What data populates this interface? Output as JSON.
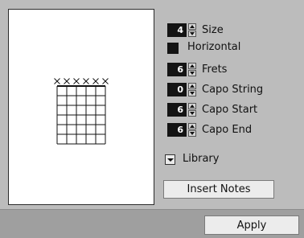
{
  "controls": {
    "size": {
      "value": "4",
      "label": "Size"
    },
    "horizontal": {
      "label": "Horizontal"
    },
    "frets": {
      "value": "6",
      "label": "Frets"
    },
    "capo_string": {
      "value": "0",
      "label": "Capo String"
    },
    "capo_start": {
      "value": "6",
      "label": "Capo Start"
    },
    "capo_end": {
      "value": "6",
      "label": "Capo End"
    },
    "library": {
      "label": "Library"
    }
  },
  "buttons": {
    "insert_notes": "Insert Notes",
    "apply": "Apply"
  },
  "chord_diagram": {
    "strings": 6,
    "frets": 6,
    "muted_strings": [
      1,
      2,
      3,
      4,
      5,
      6
    ]
  }
}
